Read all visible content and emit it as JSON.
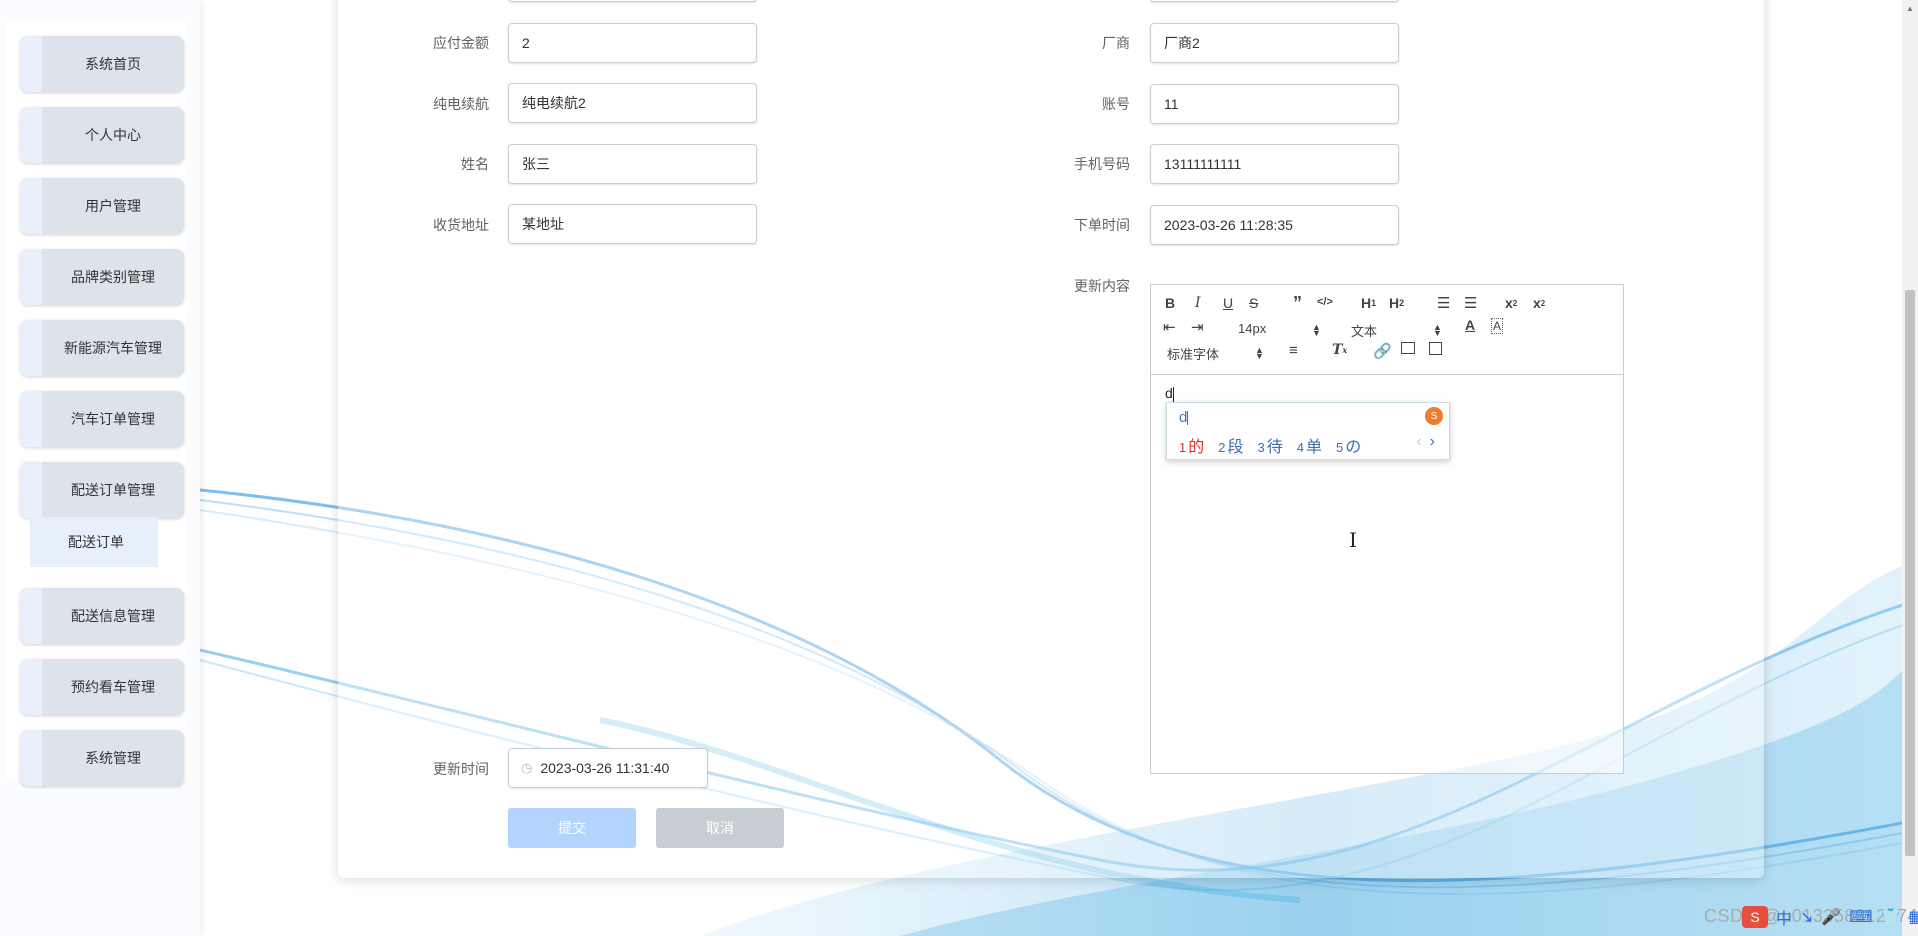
{
  "sidebar": {
    "items": [
      {
        "label": "系统首页"
      },
      {
        "label": "个人中心"
      },
      {
        "label": "用户管理"
      },
      {
        "label": "品牌类别管理"
      },
      {
        "label": "新能源汽车管理"
      },
      {
        "label": "汽车订单管理"
      },
      {
        "label": "配送订单管理"
      },
      {
        "label": "配送信息管理"
      },
      {
        "label": "预约看车管理"
      },
      {
        "label": "系统管理"
      }
    ],
    "submenu_label": "配送订单"
  },
  "form": {
    "amount": {
      "label": "应付金额",
      "value": "2"
    },
    "range": {
      "label": "纯电续航",
      "value": "纯电续航2"
    },
    "name": {
      "label": "姓名",
      "value": "张三"
    },
    "address": {
      "label": "收货地址",
      "value": "某地址"
    },
    "vendor": {
      "label": "厂商",
      "value": "厂商2"
    },
    "account": {
      "label": "账号",
      "value": "11"
    },
    "phone": {
      "label": "手机号码",
      "value": "13111111111"
    },
    "order_time": {
      "label": "下单时间",
      "value": "2023-03-26 11:28:35"
    },
    "content": {
      "label": "更新内容",
      "text": "d"
    },
    "update_time": {
      "label": "更新时间",
      "value": "2023-03-26 11:31:40"
    },
    "submit_label": "提交",
    "cancel_label": "取消"
  },
  "editor": {
    "font_size": "14px",
    "header_select": "文本",
    "font_family": "标准字体"
  },
  "ime": {
    "input": "d",
    "candidates": [
      {
        "num": "1",
        "text": "的"
      },
      {
        "num": "2",
        "text": "段"
      },
      {
        "num": "3",
        "text": "待"
      },
      {
        "num": "4",
        "text": "单"
      },
      {
        "num": "5",
        "text": "の"
      }
    ]
  },
  "watermark": "CSDN @u013358812174",
  "colors": {
    "submit_bg": "#b3d4fc",
    "cancel_bg": "#c8cdd3",
    "menu_bg": "#dde3ea",
    "wave": "#3fa8e6"
  },
  "icons": [
    "bold-icon",
    "italic-icon",
    "underline-icon",
    "strike-icon",
    "blockquote-icon",
    "code-icon",
    "h1-icon",
    "h2-icon",
    "ordered-list-icon",
    "bullet-list-icon",
    "subscript-icon",
    "superscript-icon",
    "indent-decrease-icon",
    "indent-increase-icon",
    "font-color-icon",
    "background-color-icon",
    "align-icon",
    "clear-format-icon",
    "link-icon",
    "image-icon",
    "video-icon",
    "calendar-icon",
    "sogou-icon"
  ]
}
